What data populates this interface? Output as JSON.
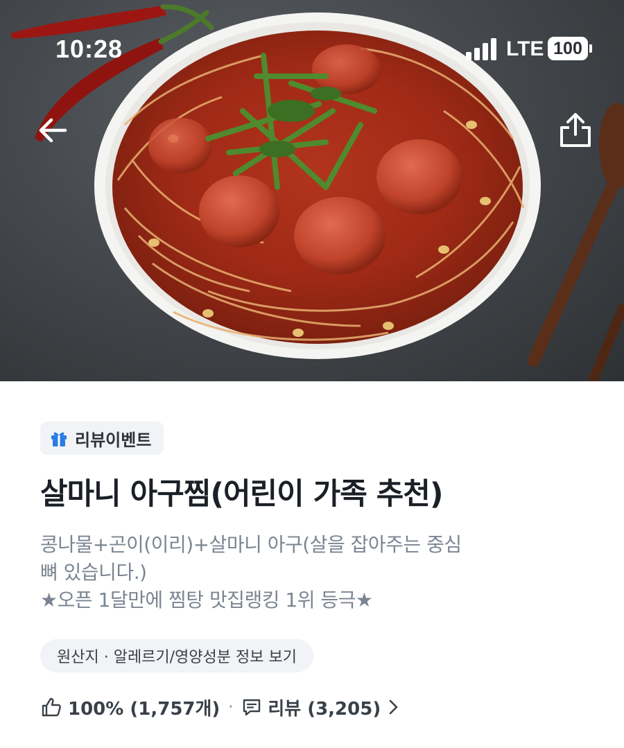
{
  "status_bar": {
    "time": "10:28",
    "network": "LTE",
    "battery": "100"
  },
  "hero": {
    "back_icon": "arrow-left-icon",
    "share_icon": "share-icon",
    "image": "food-photo"
  },
  "event_badge": {
    "icon": "gift-icon",
    "label": "리뷰이벤트"
  },
  "product": {
    "title": "살마니 아구찜(어린이 가족 추천)",
    "description_lines": [
      "콩나물+곤이(이리)+살마니 아구(살을 잡아주는 중심",
      "뼈 있습니다.)",
      "★오픈 1달만에 찜탕 맛집랭킹 1위 등극★"
    ]
  },
  "info_chip": {
    "label": "원산지 · 알레르기/영양성분 정보 보기"
  },
  "stats": {
    "like_icon": "thumbs-up-icon",
    "like_text": "100% (1,757개)",
    "separator": "·",
    "review_icon": "comment-icon",
    "review_text": "리뷰 (3,205)",
    "chevron_icon": "chevron-right-icon"
  },
  "colors": {
    "badge_bg": "#f1f3f6",
    "gift_blue": "#2a7de1",
    "title": "#1b1f26",
    "desc": "#7b8491"
  }
}
